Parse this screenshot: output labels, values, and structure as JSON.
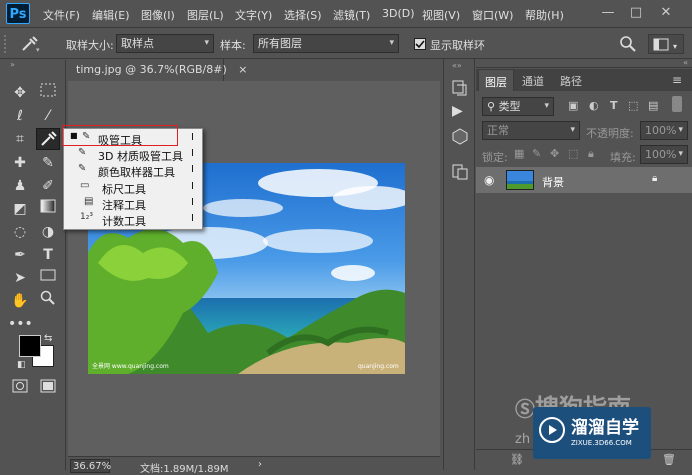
{
  "app": {
    "logo": "Ps"
  },
  "menu": [
    "文件(F)",
    "编辑(E)",
    "图像(I)",
    "图层(L)",
    "文字(Y)",
    "选择(S)",
    "滤镜(T)",
    "3D(D)",
    "视图(V)",
    "窗口(W)",
    "帮助(H)"
  ],
  "window_controls": {
    "minimize": "—",
    "maximize": "□",
    "close": "✕"
  },
  "options": {
    "sample_size_label": "取样大小:",
    "sample_size_value": "取样点",
    "sample_label": "样本:",
    "sample_value": "所有图层",
    "show_ring_label": "显示取样环",
    "show_ring_checked": true
  },
  "document": {
    "tab_title": "timg.jpg @ 36.7%(RGB/8#)",
    "tab_close": "×",
    "zoom": "36.67%",
    "doc_info": "文档:1.89M/1.89M",
    "photo_caption_left": "全景网 www.quanjing.com",
    "photo_caption_right": "quanjing.com"
  },
  "flyout": {
    "items": [
      {
        "label": "吸管工具",
        "key": "I",
        "icon": "eyedropper-icon",
        "selected": true
      },
      {
        "label": "3D 材质吸管工具",
        "key": "I",
        "icon": "3d-eyedropper-icon",
        "selected": false
      },
      {
        "label": "颜色取样器工具",
        "key": "I",
        "icon": "color-sampler-icon",
        "selected": false
      },
      {
        "label": "标尺工具",
        "key": "I",
        "icon": "ruler-icon",
        "selected": false
      },
      {
        "label": "注释工具",
        "key": "I",
        "icon": "note-icon",
        "selected": false
      },
      {
        "label": "计数工具",
        "key": "I",
        "icon": "count-icon",
        "selected": false
      }
    ]
  },
  "layers_panel": {
    "tabs": [
      "图层",
      "通道",
      "路径"
    ],
    "filter_label": "类型",
    "blend_mode": "正常",
    "opacity_label": "不透明度:",
    "opacity_value": "100%",
    "lock_label": "锁定:",
    "fill_label": "填充:",
    "fill_value": "100%",
    "layer_name": "背景"
  },
  "watermarks": {
    "sogou": "搜狗指南",
    "brand": "溜溜自学",
    "brand_url": "ZIXUE.3D66.COM",
    "partial": "zh"
  },
  "colors": {
    "ui_bg": "#535353",
    "canvas_bg": "#5f5f5f",
    "highlight": "#e02020",
    "foreground_swatch": "#000000",
    "background_swatch": "#ffffff"
  }
}
